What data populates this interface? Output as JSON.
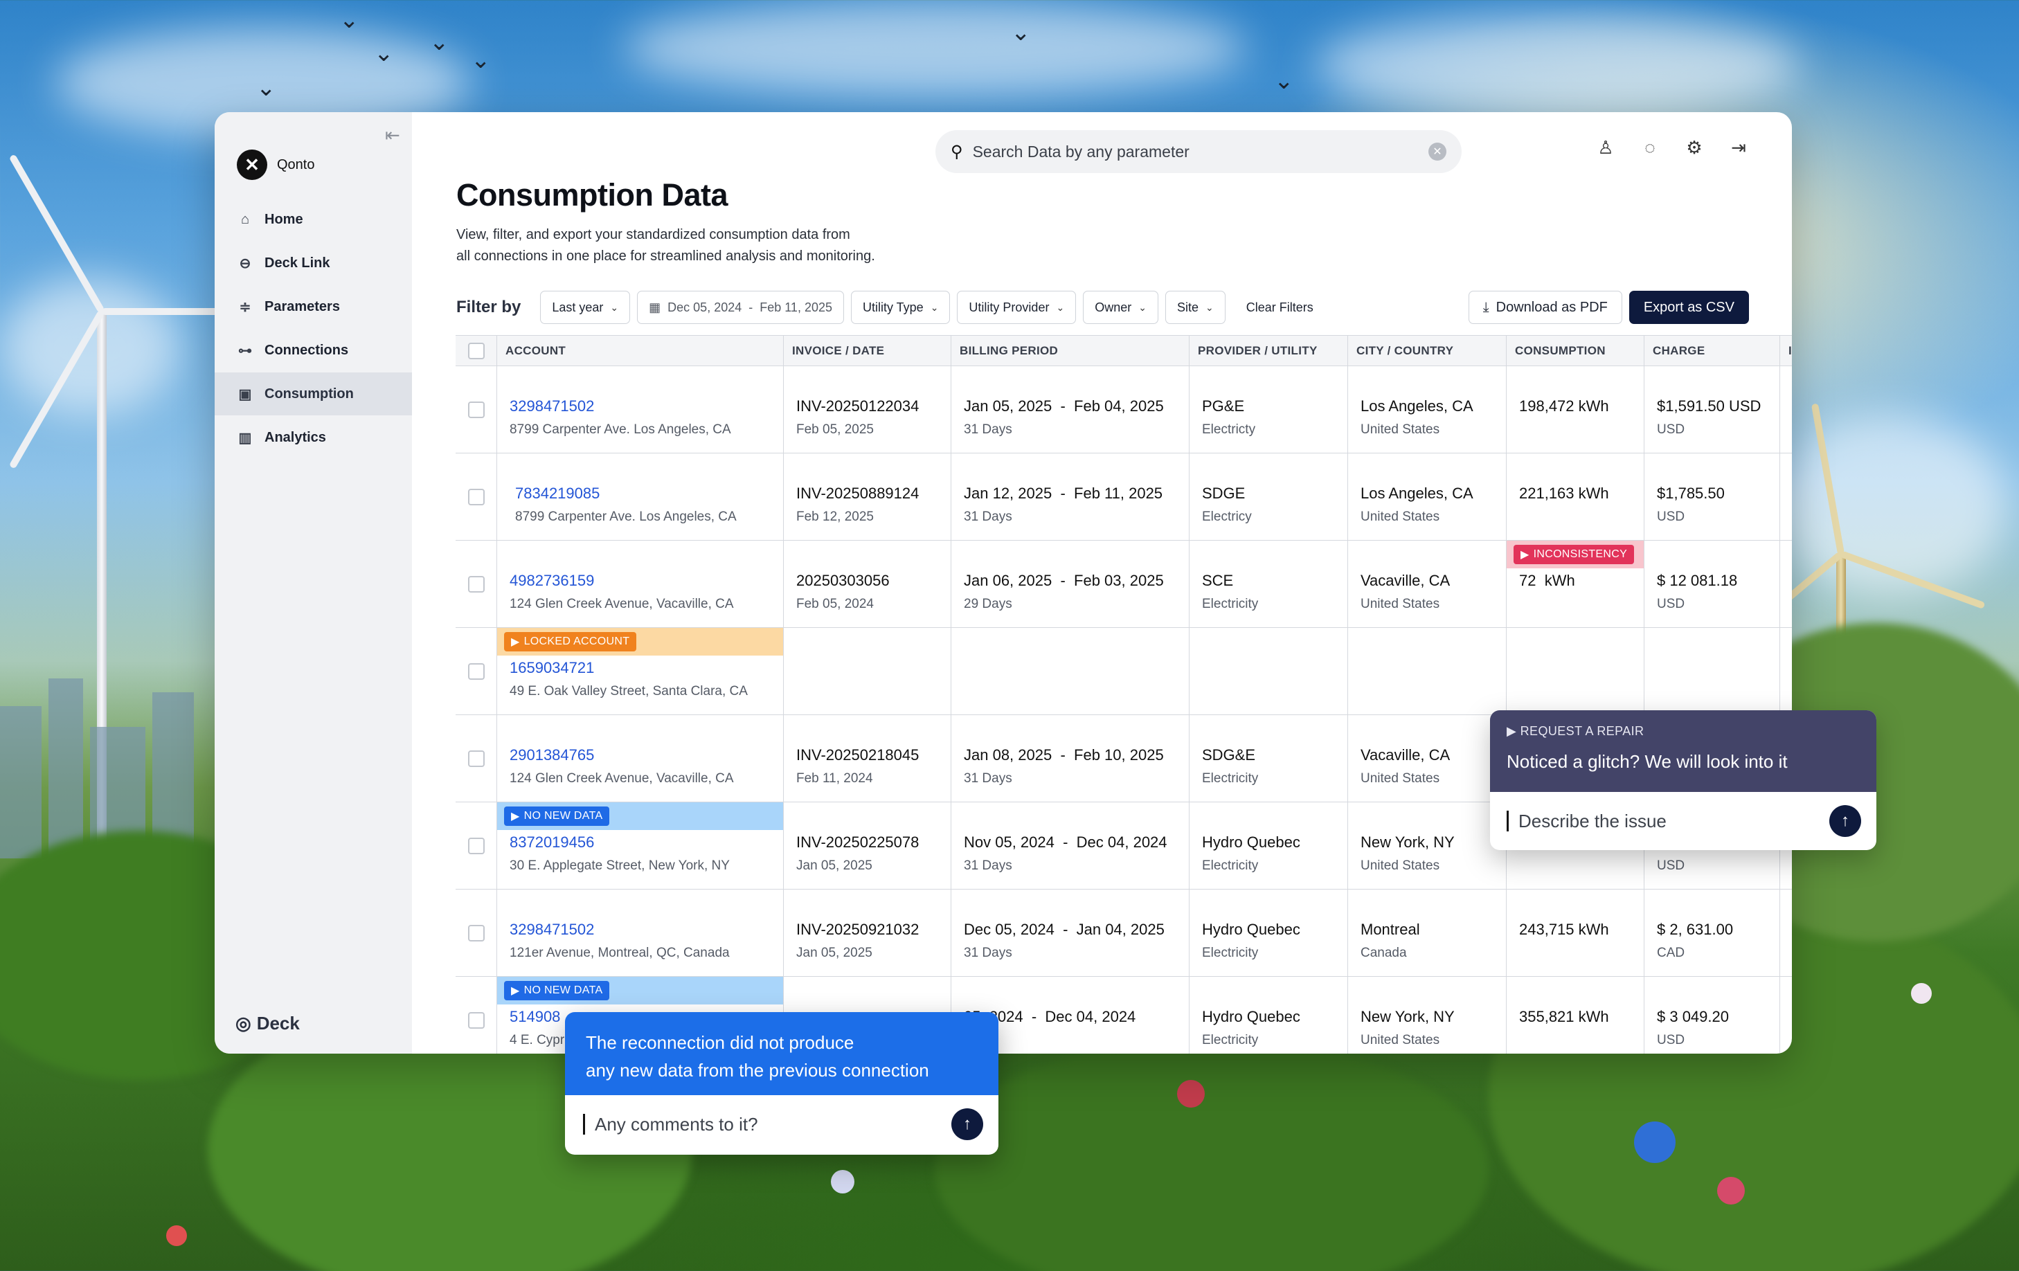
{
  "sidebar": {
    "org_name": "Qonto",
    "items": [
      {
        "label": "Home",
        "icon": "home-icon"
      },
      {
        "label": "Deck Link",
        "icon": "link-icon"
      },
      {
        "label": "Parameters",
        "icon": "sliders-icon"
      },
      {
        "label": "Connections",
        "icon": "connections-icon"
      },
      {
        "label": "Consumption",
        "icon": "consumption-icon",
        "active": true
      },
      {
        "label": "Analytics",
        "icon": "bar-chart-icon"
      }
    ],
    "brand": "Deck"
  },
  "search": {
    "placeholder": "Search Data by any parameter"
  },
  "page": {
    "title": "Consumption Data",
    "description_line1": "View, filter, and export your standardized consumption data from",
    "description_line2": "all connections in one place for streamlined analysis and monitoring."
  },
  "filters": {
    "label": "Filter by",
    "period": "Last year",
    "date_start": "Dec 05, 2024",
    "date_end": "Feb 11, 2025",
    "utility_type": "Utility Type",
    "utility_provider": "Utility Provider",
    "owner": "Owner",
    "site": "Site",
    "clear": "Clear Filters",
    "download_pdf": "Download as PDF",
    "export_csv": "Export as CSV"
  },
  "table": {
    "headers": [
      "ACCOUNT",
      "INVOICE / DATE",
      "BILLING PERIOD",
      "PROVIDER / UTILITY",
      "CITY / COUNTRY",
      "CONSUMPTION",
      "CHARGE",
      "IN"
    ],
    "rows": [
      {
        "account": "3298471502",
        "address": "8799 Carpenter Ave. Los Angeles, CA",
        "invoice": "INV-20250122034",
        "invoice_date": "Feb 05, 2025",
        "period_start": "Jan 05, 2025",
        "period_end": "Feb 04, 2025",
        "days": "31 Days",
        "provider": "PG&E",
        "utility": "Electricty",
        "city": "Los Angeles, CA",
        "country": "United States",
        "consumption": "198,472 kWh",
        "charge": "$1,591.50 USD",
        "currency": "USD"
      },
      {
        "account": "7834219085",
        "address": "8799 Carpenter Ave. Los Angeles, CA",
        "invoice": "INV-20250889124",
        "invoice_date": "Feb 12, 2025",
        "period_start": "Jan 12, 2025",
        "period_end": "Feb 11, 2025",
        "days": "31 Days",
        "provider": "SDGE",
        "utility": "Electricy",
        "city": "Los Angeles, CA",
        "country": "United States",
        "consumption": "221,163 kWh",
        "charge": "$1,785.50",
        "currency": "USD"
      },
      {
        "account": "4982736159",
        "address": "124 Glen Creek Avenue, Vacaville, CA",
        "invoice": "20250303056",
        "invoice_date": "Feb 05, 2024",
        "period_start": "Jan 06, 2025",
        "period_end": "Feb 03, 2025",
        "days": "29 Days",
        "provider": "SCE",
        "utility": "Electricity",
        "city": "Vacaville, CA",
        "country": "United States",
        "consumption": "72  kWh",
        "consumption_badge": "INCONSISTENCY",
        "charge": "$ 12 081.18",
        "currency": "USD"
      },
      {
        "account": "1659034721",
        "address": "49 E. Oak Valley Street, Santa Clara, CA",
        "account_badge": "LOCKED ACCOUNT",
        "empty": true
      },
      {
        "account": "2901384765",
        "address": "124 Glen Creek Avenue, Vacaville, CA",
        "invoice": "INV-20250218045",
        "invoice_date": "Feb 11, 2024",
        "period_start": "Jan 08, 2025",
        "period_end": "Feb 10, 2025",
        "days": "31 Days",
        "provider": "SDG&E",
        "utility": "Electricity",
        "city": "Vacaville, CA",
        "country": "United States",
        "consumption": "",
        "charge": "",
        "currency": ""
      },
      {
        "account": "8372019456",
        "address": "30 E. Applegate Street, New York, NY",
        "account_badge": "NO NEW DATA",
        "invoice": "INV-20250225078",
        "invoice_date": "Jan 05, 2025",
        "period_start": "Nov 05, 2024",
        "period_end": "Dec 04, 2024",
        "days": "31 Days",
        "provider": "Hydro Quebec",
        "utility": "Electricity",
        "city": "New York, NY",
        "country": "United States",
        "consumption": "",
        "charge": "",
        "currency": "USD"
      },
      {
        "account": "3298471502",
        "address": "121er Avenue, Montreal, QC, Canada",
        "invoice": "INV-20250921032",
        "invoice_date": "Jan 05, 2025",
        "period_start": "Dec 05, 2024",
        "period_end": "Jan 04, 2025",
        "days": "31 Days",
        "provider": "Hydro Quebec",
        "utility": "Electricity",
        "city": "Montreal",
        "country": "Canada",
        "consumption": "243,715 kWh",
        "charge": "$ 2, 631.00",
        "currency": "CAD"
      },
      {
        "account": "514908",
        "address": "4 E. Cypr",
        "account_badge": "NO NEW DATA",
        "invoice": "",
        "invoice_date": "",
        "period_start": "05, 2024",
        "period_end": "Dec 04, 2024",
        "days": "ys",
        "provider": "Hydro Quebec",
        "utility": "Electricity",
        "city": "New York, NY",
        "country": "United States",
        "consumption": "355,821 kWh",
        "charge": "$ 3 049.20",
        "currency": "USD"
      }
    ]
  },
  "repair_popover": {
    "kicker": "REQUEST A REPAIR",
    "message": "Noticed a glitch? We will look into it",
    "placeholder": "Describe the issue"
  },
  "reconnect_popover": {
    "line1": "The reconnection did not produce",
    "line2": "any new data from the previous connection",
    "placeholder": "Any comments to it?"
  },
  "colors": {
    "accent": "#0e1a3d",
    "link": "#2355d6",
    "repair_header": "#434468",
    "reconnect_header": "#1c6ee8",
    "locked": "#f0821e",
    "no_new_data": "#1f6ae6",
    "inconsistency": "#e2335a"
  }
}
